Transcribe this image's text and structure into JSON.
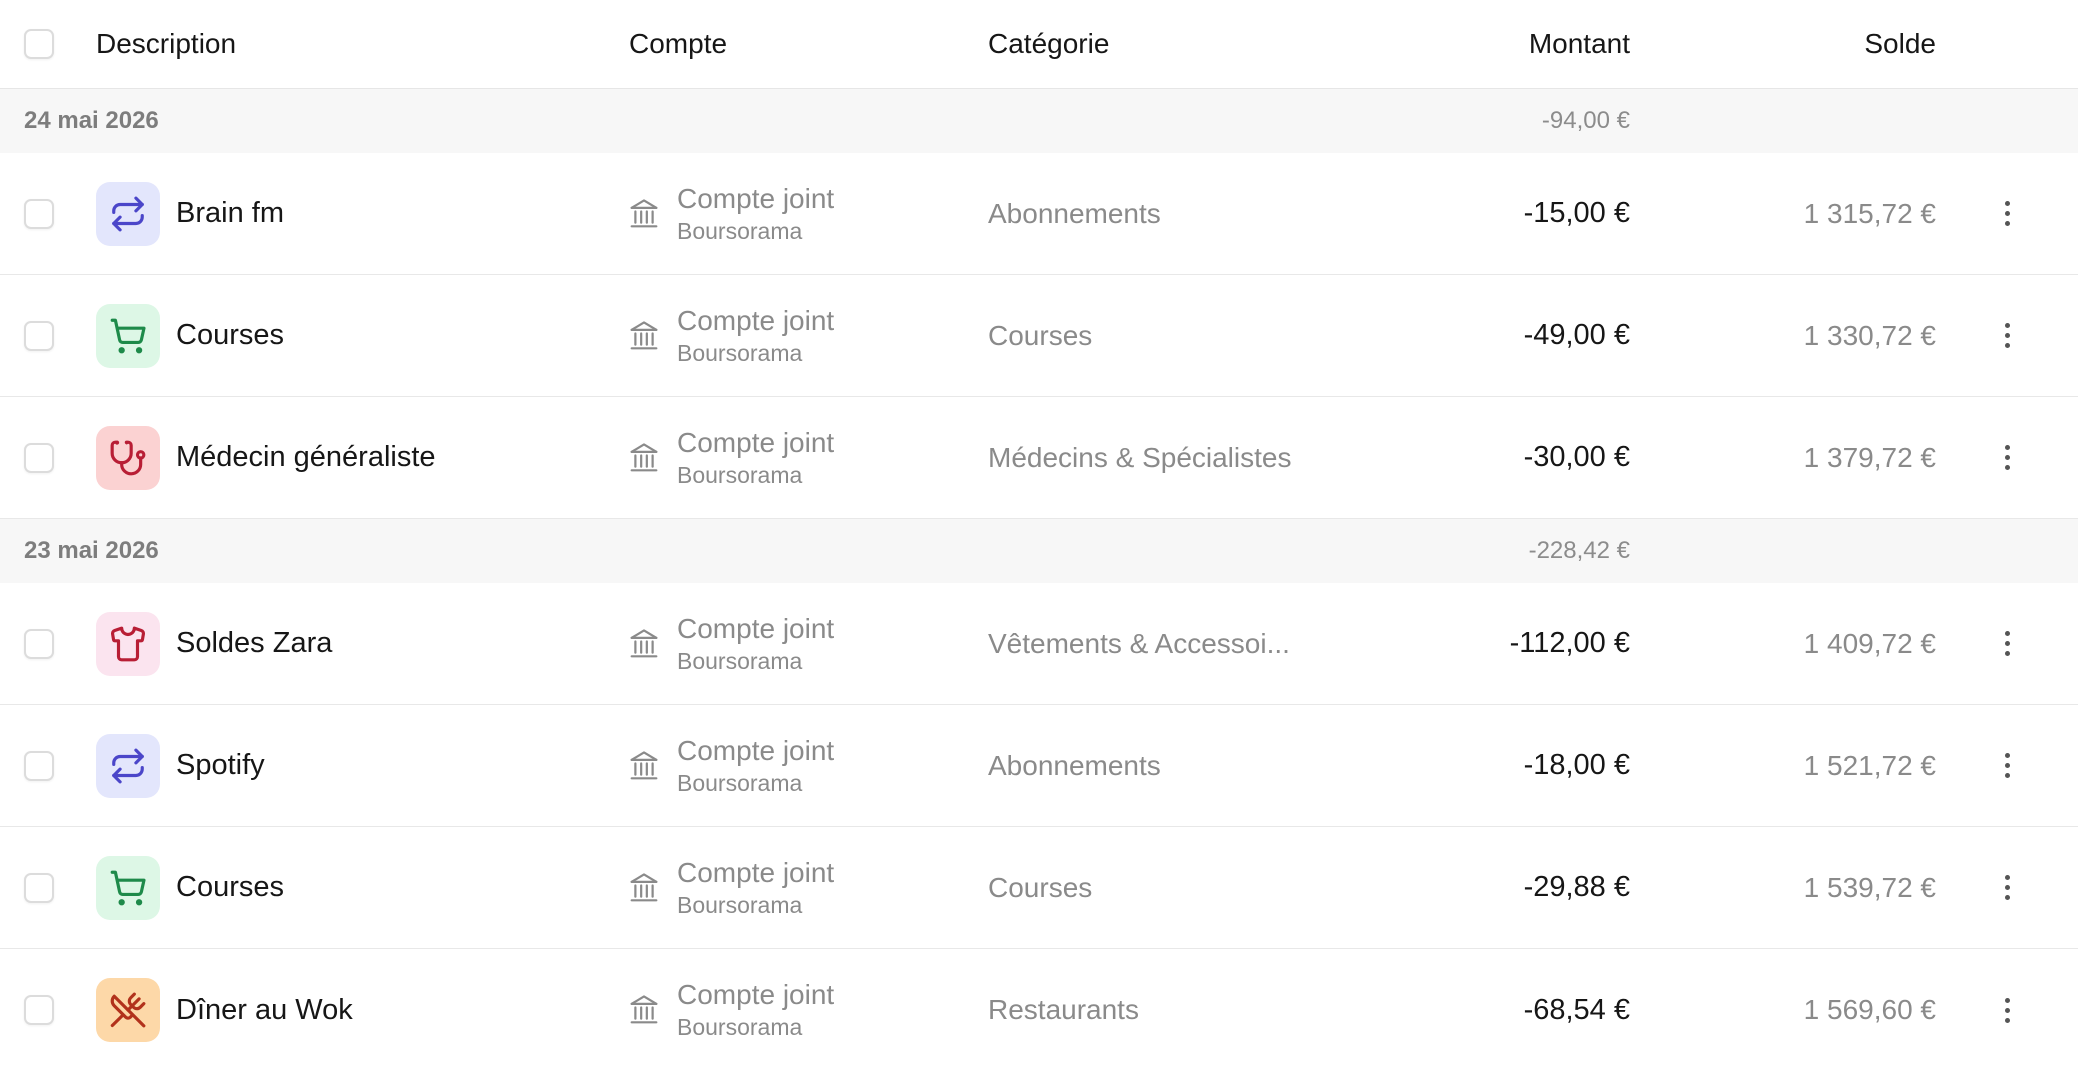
{
  "header": {
    "description": "Description",
    "compte": "Compte",
    "categorie": "Catégorie",
    "montant": "Montant",
    "solde": "Solde"
  },
  "groups": [
    {
      "date": "24 mai 2026",
      "total": "-94,00 €",
      "rows": [
        {
          "description": "Brain fm",
          "icon": "repeat-icon",
          "icon_bg": "#e3e6fc",
          "icon_color": "#4b46c9",
          "account": "Compte joint",
          "bank": "Boursorama",
          "category": "Abonnements",
          "amount": "-15,00 €",
          "balance": "1 315,72 €"
        },
        {
          "description": "Courses",
          "icon": "shopping-cart-icon",
          "icon_bg": "#ddf7e6",
          "icon_color": "#1e8a4a",
          "account": "Compte joint",
          "bank": "Boursorama",
          "category": "Courses",
          "amount": "-49,00 €",
          "balance": "1 330,72 €"
        },
        {
          "description": "Médecin généraliste",
          "icon": "stethoscope-icon",
          "icon_bg": "#fbd2d2",
          "icon_color": "#b81e35",
          "account": "Compte joint",
          "bank": "Boursorama",
          "category": "Médecins & Spécialistes",
          "amount": "-30,00 €",
          "balance": "1 379,72 €"
        }
      ]
    },
    {
      "date": "23 mai 2026",
      "total": "-228,42 €",
      "rows": [
        {
          "description": "Soldes Zara",
          "icon": "shirt-icon",
          "icon_bg": "#fbe4ef",
          "icon_color": "#b81e35",
          "account": "Compte joint",
          "bank": "Boursorama",
          "category": "Vêtements & Accessoi...",
          "amount": "-112,00 €",
          "balance": "1 409,72 €"
        },
        {
          "description": "Spotify",
          "icon": "repeat-icon",
          "icon_bg": "#e3e6fc",
          "icon_color": "#4b46c9",
          "account": "Compte joint",
          "bank": "Boursorama",
          "category": "Abonnements",
          "amount": "-18,00 €",
          "balance": "1 521,72 €"
        },
        {
          "description": "Courses",
          "icon": "shopping-cart-icon",
          "icon_bg": "#ddf7e6",
          "icon_color": "#1e8a4a",
          "account": "Compte joint",
          "bank": "Boursorama",
          "category": "Courses",
          "amount": "-29,88 €",
          "balance": "1 539,72 €"
        },
        {
          "description": "Dîner au Wok",
          "icon": "utensils-crossed-icon",
          "icon_bg": "#fdd8a8",
          "icon_color": "#b2321c",
          "account": "Compte joint",
          "bank": "Boursorama",
          "category": "Restaurants",
          "amount": "-68,54 €",
          "balance": "1 569,60 €"
        }
      ]
    }
  ]
}
